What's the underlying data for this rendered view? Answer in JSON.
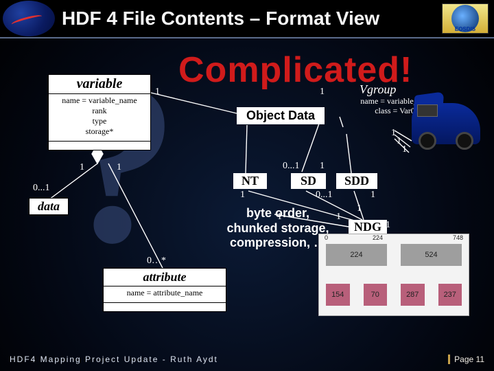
{
  "header": {
    "title": "HDF 4 File Contents – Format View",
    "nasa_alt": "NASA",
    "eosdis_label": "EOSDIS"
  },
  "banner": "Complicated!",
  "qmark": "?",
  "uml": {
    "variable": {
      "title": "variable",
      "lines": [
        "name = variable_name",
        "rank",
        "type",
        "storage*"
      ]
    },
    "data": {
      "title": "data"
    },
    "attribute": {
      "title": "attribute",
      "lines": [
        "name = attribute_name"
      ]
    },
    "object_data": "Object Data",
    "vgroup": {
      "title": "Vgroup",
      "lines": [
        "name = variable_name",
        "class = Var0.0"
      ]
    },
    "nt": "NT",
    "sd": "SD",
    "sdd": "SDD",
    "ndg": "NDG"
  },
  "cardinalities": {
    "var_to_obj_left": "1",
    "var_to_obj_right": "1",
    "var_to_data_top": "1",
    "var_to_data_bottom": "1",
    "var_to_data_side": "0...1",
    "var_to_attr": "0…*",
    "sd_top_left": "0...1",
    "sd_top_right": "1",
    "nt_bottom": "1",
    "sdd_left": "0...1",
    "sdd_right": "1",
    "ndg_top": "1",
    "ndg_right_1": "1",
    "vgroup_r1": "1",
    "vgroup_r2": "1",
    "vgroup_r3": "1",
    "storage_left": "1",
    "storage_right": "1"
  },
  "storage_text": "byte order,\nchunked storage,\ncompression, …",
  "inset": {
    "ticks": [
      "0",
      "224",
      "748"
    ],
    "cells": [
      "224",
      "524",
      "154",
      "70",
      "287",
      "237"
    ]
  },
  "footer": "HDF4  Mapping  Project  Update  -  Ruth Aydt",
  "page": "Page 11"
}
